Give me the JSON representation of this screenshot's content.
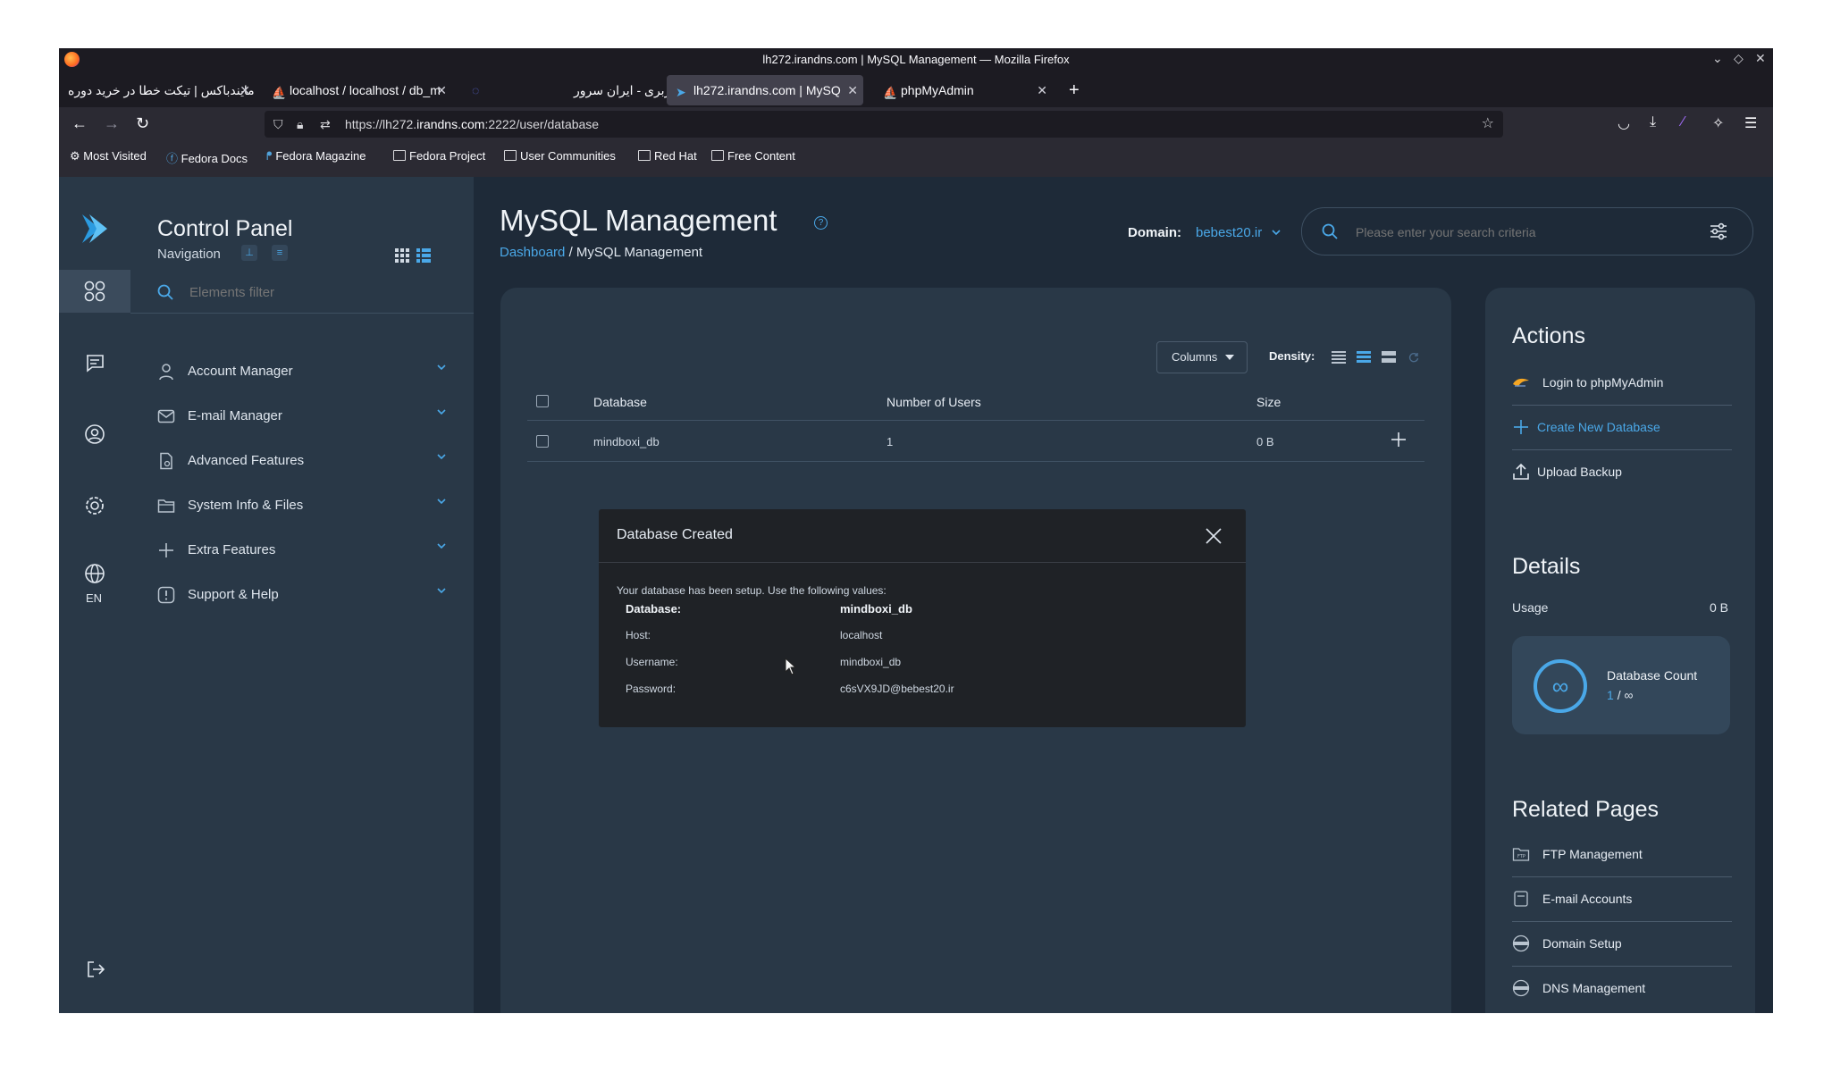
{
  "browser": {
    "window_title": "lh272.irandns.com | MySQL Management — Mozilla Firefox",
    "tabs": [
      {
        "label": "مایندباکس | تیکت خطا در خرید دوره"
      },
      {
        "label": "localhost / localhost / db_m"
      },
      {
        "label": ""
      },
      {
        "label": "صفحه کاربری - ایران سرور"
      },
      {
        "label": "lh272.irandns.com | MySQ"
      },
      {
        "label": "phpMyAdmin"
      }
    ],
    "url_prefix": "https://lh272.",
    "url_host": "irandns.com",
    "url_suffix": ":2222/user/database",
    "bookmarks": [
      {
        "label": "Most Visited"
      },
      {
        "label": "Fedora Docs"
      },
      {
        "label": "Fedora Magazine"
      },
      {
        "label": "Fedora Project"
      },
      {
        "label": "User Communities"
      },
      {
        "label": "Red Hat"
      },
      {
        "label": "Free Content"
      }
    ]
  },
  "sidebar": {
    "title": "Control Panel",
    "subtitle": "Navigation",
    "filter_placeholder": "Elements filter",
    "language": "EN",
    "items": [
      {
        "label": "Account Manager"
      },
      {
        "label": "E-mail Manager"
      },
      {
        "label": "Advanced Features"
      },
      {
        "label": "System Info & Files"
      },
      {
        "label": "Extra Features"
      },
      {
        "label": "Support & Help"
      }
    ]
  },
  "header": {
    "title": "MySQL Management",
    "breadcrumb_link": "Dashboard",
    "breadcrumb_sep": "/",
    "breadcrumb_current": "MySQL Management",
    "domain_label": "Domain:",
    "domain_value": "bebest20.ir",
    "search_placeholder": "Please enter your search criteria"
  },
  "table": {
    "columns_button": "Columns",
    "density_label": "Density:",
    "headers": {
      "database": "Database",
      "users": "Number of Users",
      "size": "Size"
    },
    "rows": [
      {
        "database": "mindboxi_db",
        "users": "1",
        "size": "0 B"
      }
    ]
  },
  "modal": {
    "title": "Database Created",
    "intro": "Your database has been setup. Use the following values:",
    "database_label": "Database:",
    "database_value": "mindboxi_db",
    "host_label": "Host:",
    "host_value": "localhost",
    "username_label": "Username:",
    "username_value": "mindboxi_db",
    "password_label": "Password:",
    "password_value": "c6sVX9JD@bebest20.ir"
  },
  "actions": {
    "title": "Actions",
    "items": [
      {
        "label": "Login to phpMyAdmin"
      },
      {
        "label": "Create New Database"
      },
      {
        "label": "Upload Backup"
      }
    ]
  },
  "details": {
    "title": "Details",
    "usage_label": "Usage",
    "usage_value": "0 B",
    "count_label": "Database Count",
    "count_used": "1",
    "count_sep": "/",
    "count_limit": "∞",
    "circle_symbol": "∞"
  },
  "related": {
    "title": "Related Pages",
    "items": [
      {
        "label": "FTP Management"
      },
      {
        "label": "E-mail Accounts"
      },
      {
        "label": "Domain Setup"
      },
      {
        "label": "DNS Management"
      }
    ]
  },
  "colors": {
    "accent": "#4aa8e8",
    "page_bg": "#1e2a38",
    "card_bg": "#293847",
    "modal_bg": "#1f2226"
  }
}
